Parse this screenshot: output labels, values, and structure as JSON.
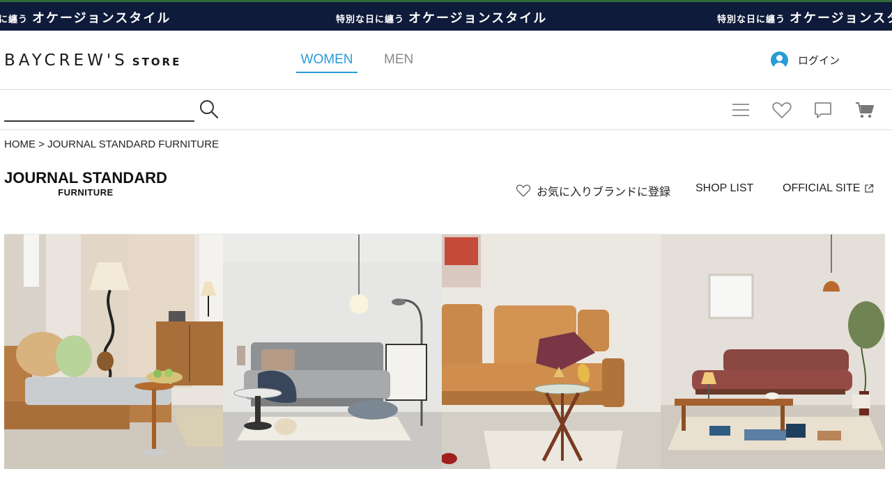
{
  "banner": {
    "items": [
      {
        "small": "に纏う",
        "big": "オケージョンスタイル"
      },
      {
        "small": "特別な日に纏う",
        "big": "オケージョンスタイル"
      },
      {
        "small": "特別な日に纏う",
        "big": "オケージョンスタイル"
      }
    ]
  },
  "header": {
    "logo_main": "BAYCREW'S",
    "logo_sub": "STORE",
    "tabs": [
      {
        "label": "WOMEN",
        "active": true
      },
      {
        "label": "MEN",
        "active": false
      }
    ],
    "login_label": "ログイン"
  },
  "toolbar": {
    "search_value": "",
    "icons": [
      "menu-icon",
      "heart-icon",
      "chat-icon",
      "cart-icon"
    ]
  },
  "breadcrumb": {
    "home": "HOME",
    "separator": ">",
    "current": "JOURNAL STANDARD FURNITURE"
  },
  "brand": {
    "logo_line1": "JOURNAL STANDARD",
    "logo_line2": "FURNITURE",
    "favorite_label": "お気に入りブランドに登録",
    "shop_list_label": "SHOP LIST",
    "official_site_label": "OFFICIAL SITE"
  },
  "colors": {
    "banner_bg": "#0f1b3a",
    "accent": "#2a9bd6",
    "inactive_tab": "#888888"
  }
}
